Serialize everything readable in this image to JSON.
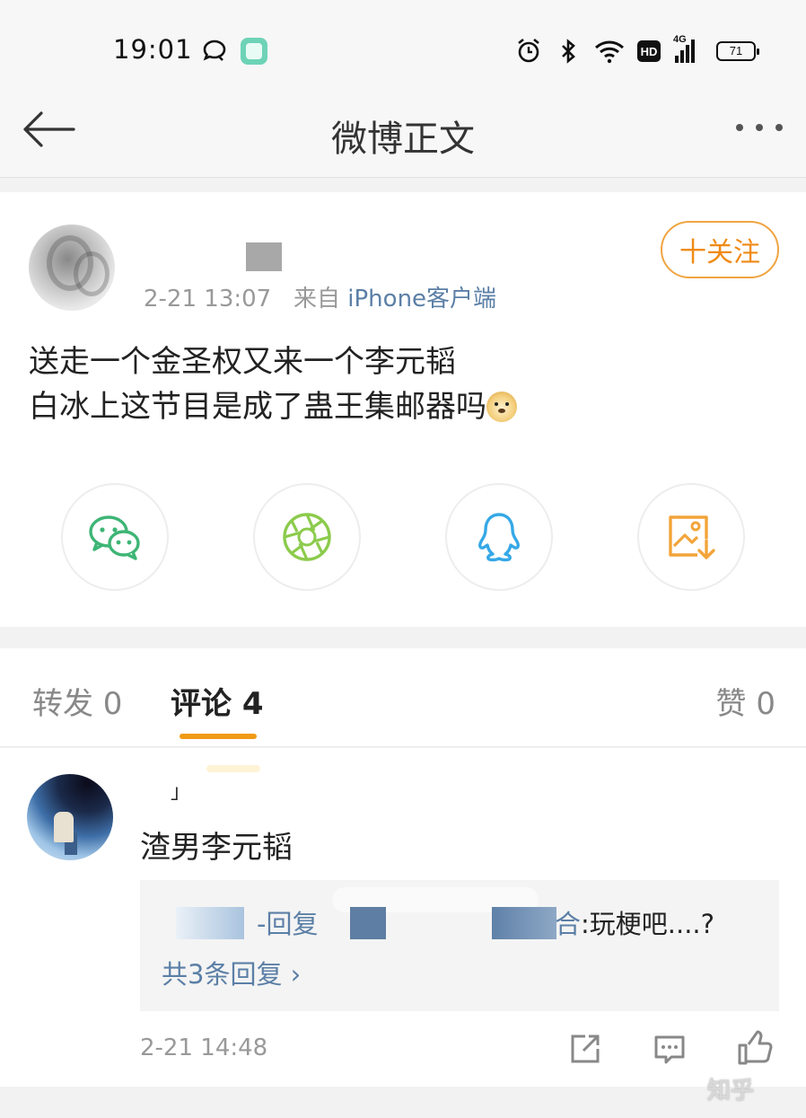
{
  "status_bar": {
    "time": "19:01",
    "network_label": "4G",
    "battery_level": "71",
    "icons": [
      "chat-bubble-icon",
      "app-icon",
      "alarm-icon",
      "bluetooth-icon",
      "wifi-icon",
      "hd-icon",
      "signal-icon",
      "battery-icon"
    ]
  },
  "nav": {
    "title": "微博正文",
    "back_icon": "arrow-left-icon",
    "more_icon": "more-dots-icon"
  },
  "post": {
    "timestamp": "2-21 13:07",
    "source_prefix": "来自",
    "source": "iPhone客户端",
    "follow_label": "十关注",
    "text_line1": "送走一个金圣权又来一个李元韬",
    "text_line2": "白冰上这节目是成了蛊王集邮器吗",
    "emoji": "doge-emoji"
  },
  "share": {
    "items": [
      "wechat",
      "moments",
      "qq",
      "save-image"
    ],
    "colors": {
      "wechat": "#3eb575",
      "moments": "#8ccb4c",
      "qq": "#35a8e6",
      "save-image": "#f2a43a"
    }
  },
  "tabs": {
    "repost": "转发 0",
    "comment": "评论 4",
    "like": "赞 0",
    "active_color": "#f19a16"
  },
  "comment": {
    "name_mark": "」",
    "text": "渣男李元韬",
    "reply_mid": "-回复",
    "reply_tail_link": "合",
    "reply_tail": ":玩梗吧....?",
    "more_replies": "共3条回复 ›",
    "timestamp": "2-21 14:48"
  },
  "watermark": "知乎"
}
